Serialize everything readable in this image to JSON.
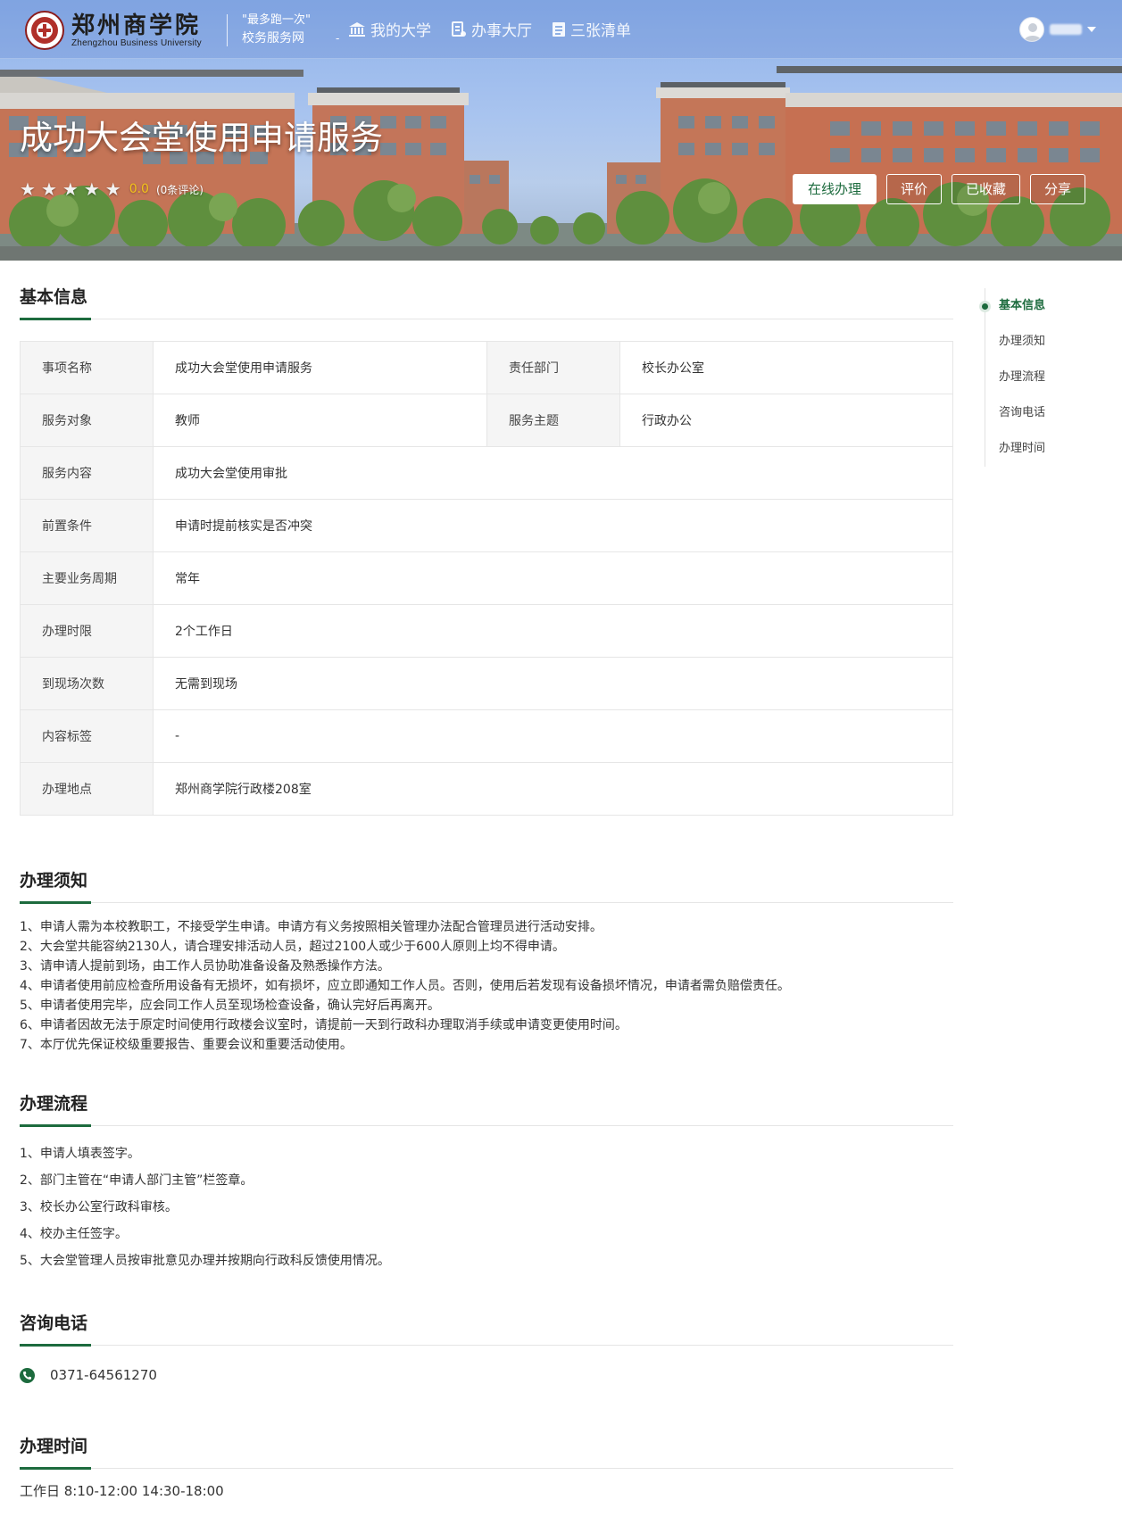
{
  "header": {
    "school_name_cn": "郑州商学院",
    "school_name_en": "Zhengzhou Business University",
    "slogan_line1": "\"最多跑一次\"",
    "slogan_line2": "校务服务网",
    "separator": "-",
    "nav": [
      {
        "label": "我的大学",
        "icon": "university-icon"
      },
      {
        "label": "办事大厅",
        "icon": "service-hall-icon"
      },
      {
        "label": "三张清单",
        "icon": "list-icon"
      }
    ]
  },
  "hero": {
    "title": "成功大会堂使用申请服务",
    "stars": [
      "★",
      "★",
      "★",
      "★",
      "★"
    ],
    "score": "0.0",
    "reviews": "(0条评论)",
    "buttons": {
      "online": "在线办理",
      "rate": "评价",
      "favorited": "已收藏",
      "share": "分享"
    }
  },
  "basic_info": {
    "title": "基本信息",
    "rows": [
      {
        "label": "事项名称",
        "value": "成功大会堂使用申请服务",
        "label2": "责任部门",
        "value2": "校长办公室"
      },
      {
        "label": "服务对象",
        "value": "教师",
        "label2": "服务主题",
        "value2": "行政办公"
      },
      {
        "label": "服务内容",
        "value": "成功大会堂使用审批"
      },
      {
        "label": "前置条件",
        "value": "申请时提前核实是否冲突"
      },
      {
        "label": "主要业务周期",
        "value": "常年"
      },
      {
        "label": "办理时限",
        "value": "2个工作日"
      },
      {
        "label": "到现场次数",
        "value": "无需到现场"
      },
      {
        "label": "内容标签",
        "value": "-"
      },
      {
        "label": "办理地点",
        "value": "郑州商学院行政楼208室"
      }
    ]
  },
  "notice": {
    "title": "办理须知",
    "items": [
      "1、申请人需为本校教职工，不接受学生申请。申请方有义务按照相关管理办法配合管理员进行活动安排。",
      "2、大会堂共能容纳2130人，请合理安排活动人员，超过2100人或少于600人原则上均不得申请。",
      "3、请申请人提前到场，由工作人员协助准备设备及熟悉操作方法。",
      "4、申请者使用前应检查所用设备有无损坏，如有损坏，应立即通知工作人员。否则，使用后若发现有设备损坏情况，申请者需负赔偿责任。",
      "5、申请者使用完毕，应会同工作人员至现场检查设备，确认完好后再离开。",
      "6、申请者因故无法于原定时间使用行政楼会议室时，请提前一天到行政科办理取消手续或申请变更使用时间。",
      "7、本厅优先保证校级重要报告、重要会议和重要活动使用。"
    ]
  },
  "flow": {
    "title": "办理流程",
    "items": [
      "1、申请人填表签字。",
      "2、部门主管在“申请人部门主管”栏签章。",
      "3、校长办公室行政科审核。",
      "4、校办主任签字。",
      "5、大会堂管理人员按审批意见办理并按期向行政科反馈使用情况。"
    ]
  },
  "contact": {
    "title": "咨询电话",
    "phone": "0371-64561270"
  },
  "hours": {
    "title": "办理时间",
    "text": "工作日 8:10-12:00 14:30-18:00"
  },
  "sidenav": [
    "基本信息",
    "办理须知",
    "办理流程",
    "咨询电话",
    "办理时间"
  ],
  "colors": {
    "accent": "#1d6b3e",
    "star_score": "#f3c21a"
  }
}
